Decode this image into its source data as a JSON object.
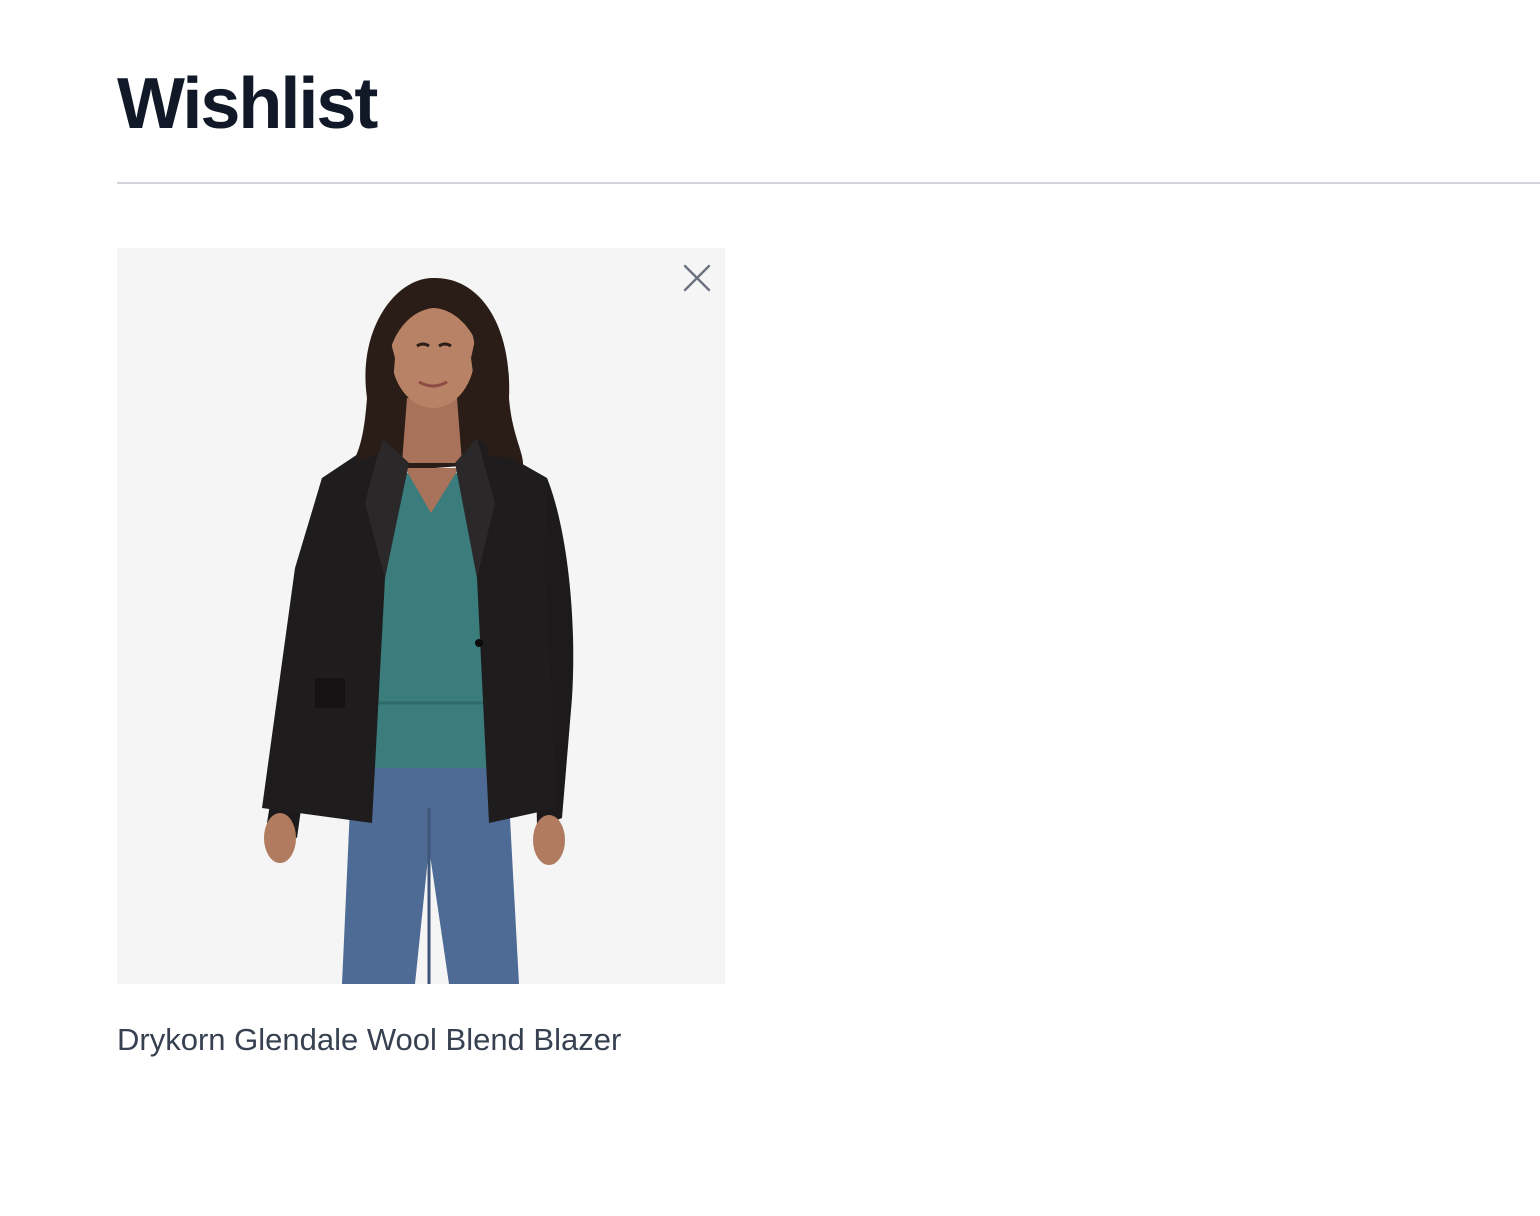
{
  "page": {
    "title": "Wishlist"
  },
  "wishlist": {
    "items": [
      {
        "name": "Drykorn Glendale Wool Blend Blazer",
        "image_icon": "product-photo-blazer",
        "remove_icon": "close-icon"
      }
    ]
  },
  "colors": {
    "title": "#111827",
    "divider": "#d1d5db",
    "image_bg": "#f5f5f5",
    "product_text": "#374151",
    "close_icon": "#6b7280"
  }
}
